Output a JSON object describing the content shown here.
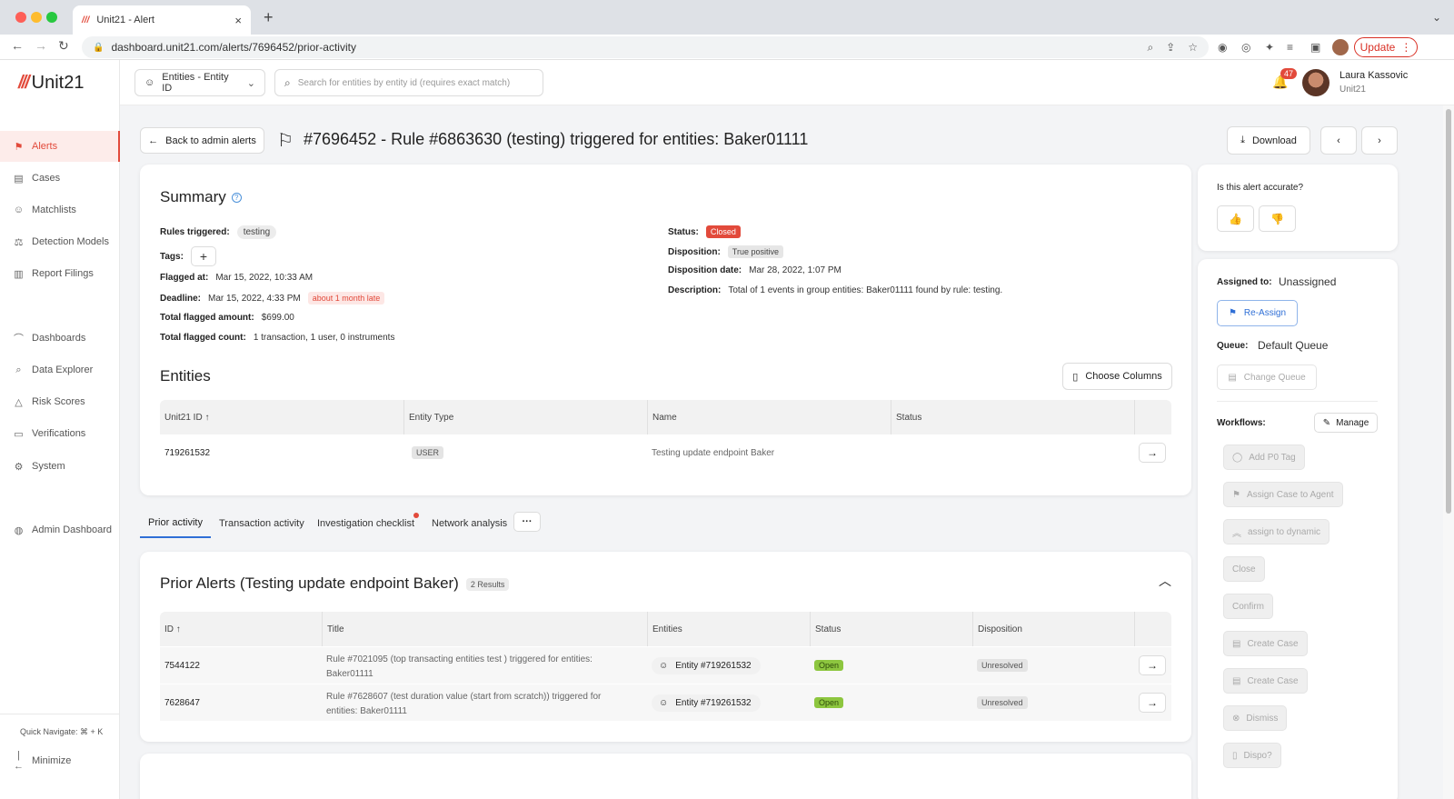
{
  "browser": {
    "tab_title": "Unit21 - Alert",
    "tab_favicon": "///",
    "url": "dashboard.unit21.com/alerts/7696452/prior-activity",
    "update_label": "Update"
  },
  "sidebar": {
    "logo_mark": "///",
    "logo_text": "Unit21",
    "items": [
      {
        "label": "Alerts",
        "icon": "flag-icon"
      },
      {
        "label": "Cases",
        "icon": "briefcase-icon"
      },
      {
        "label": "Matchlists",
        "icon": "user-list-icon"
      },
      {
        "label": "Detection Models",
        "icon": "scale-icon"
      },
      {
        "label": "Report Filings",
        "icon": "building-icon"
      },
      {
        "label": "Dashboards",
        "icon": "chart-line-icon"
      },
      {
        "label": "Data Explorer",
        "icon": "explore-icon"
      },
      {
        "label": "Risk Scores",
        "icon": "warning-icon"
      },
      {
        "label": "Verifications",
        "icon": "id-card-icon"
      },
      {
        "label": "System",
        "icon": "gear-icon"
      },
      {
        "label": "Admin Dashboard",
        "icon": "globe-icon"
      }
    ],
    "quick_navigate": "Quick Navigate: ⌘ + K",
    "minimize": "Minimize"
  },
  "topbar": {
    "entity_select": "Entities - Entity ID",
    "search_placeholder": "Search for entities by entity id (requires exact match)",
    "notification_count": "47",
    "user_name": "Laura Kassovic",
    "user_org": "Unit21"
  },
  "header": {
    "back_label": "Back to admin alerts",
    "title": "#7696452 - Rule #6863630 (testing) triggered for entities: Baker01111",
    "download_label": "Download"
  },
  "summary": {
    "title": "Summary",
    "rules_triggered_label": "Rules triggered:",
    "rules_triggered_value": "testing",
    "tags_label": "Tags:",
    "flagged_at_label": "Flagged at:",
    "flagged_at_value": "Mar 15, 2022, 10:33 AM",
    "deadline_label": "Deadline:",
    "deadline_value": "Mar 15, 2022, 4:33 PM",
    "deadline_badge": "about 1 month late",
    "total_amount_label": "Total flagged amount:",
    "total_amount_value": "$699.00",
    "total_count_label": "Total flagged count:",
    "total_count_value": "1 transaction, 1 user, 0 instruments",
    "status_label": "Status:",
    "status_value": "Closed",
    "disposition_label": "Disposition:",
    "disposition_value": "True positive",
    "disposition_date_label": "Disposition date:",
    "disposition_date_value": "Mar 28, 2022, 1:07 PM",
    "description_label": "Description:",
    "description_value": "Total of 1 events in group entities: Baker01111 found by rule: testing."
  },
  "entities": {
    "title": "Entities",
    "choose_columns": "Choose Columns",
    "columns": [
      "Unit21 ID",
      "Entity Type",
      "Name",
      "Status"
    ],
    "rows": [
      {
        "id": "719261532",
        "type": "USER",
        "name": "Testing update endpoint Baker",
        "status": ""
      }
    ]
  },
  "tabs": {
    "items": [
      "Prior activity",
      "Transaction activity",
      "Investigation checklist",
      "Network analysis"
    ],
    "more": "···"
  },
  "prior_alerts": {
    "title": "Prior Alerts (Testing update endpoint Baker)",
    "results": "2 Results",
    "columns": [
      "ID",
      "Title",
      "Entities",
      "Status",
      "Disposition"
    ],
    "rows": [
      {
        "id": "7544122",
        "title_line1": "Rule #7021095 (top transacting entities test ) triggered for entities:",
        "title_line2": "Baker01111",
        "entity": "Entity #719261532",
        "status": "Open",
        "disposition": "Unresolved"
      },
      {
        "id": "7628647",
        "title_line1": "Rule #7628607 (test duration value (start from scratch)) triggered for",
        "title_line2": "entities: Baker01111",
        "entity": "Entity #719261532",
        "status": "Open",
        "disposition": "Unresolved"
      }
    ]
  },
  "right_panel": {
    "accurate_label": "Is this alert accurate?",
    "assigned_label": "Assigned to:",
    "assigned_value": "Unassigned",
    "reassign": "Re-Assign",
    "queue_label": "Queue:",
    "queue_value": "Default Queue",
    "change_queue": "Change Queue",
    "workflows_label": "Workflows:",
    "manage": "Manage",
    "workflows": [
      {
        "label": "Add P0 Tag",
        "icon": "check-circle-icon"
      },
      {
        "label": "Assign Case to Agent",
        "icon": "flag-plus-icon"
      },
      {
        "label": "assign to dynamic",
        "icon": "chevrons-up-icon"
      },
      {
        "label": "Close",
        "icon": ""
      },
      {
        "label": "Confirm",
        "icon": ""
      },
      {
        "label": "Create Case",
        "icon": "briefcase-icon"
      },
      {
        "label": "Create Case",
        "icon": "briefcase-icon"
      },
      {
        "label": "Dismiss",
        "icon": "x-circle-icon"
      },
      {
        "label": "Dispo?",
        "icon": "document-icon"
      }
    ]
  },
  "colors": {
    "brand": "#e24a3b",
    "accent_blue": "#2f6fd6",
    "open_green": "#8dc63f"
  }
}
